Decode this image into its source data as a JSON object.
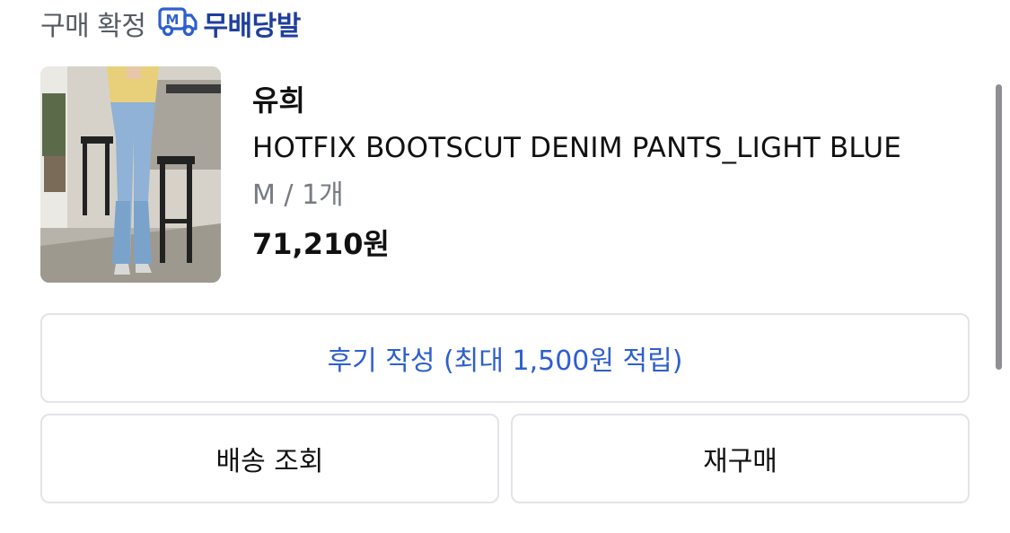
{
  "header": {
    "status": "구매 확정",
    "delivery_label": "무배당발",
    "delivery_icon": "delivery-truck-icon",
    "delivery_color": "#1f3f9d"
  },
  "product": {
    "brand": "유희",
    "name": "HOTFIX BOOTSCUT DENIM PANTS_LIGHT BLUE",
    "option": "M / 1개",
    "price": "71,210원"
  },
  "actions": {
    "review_label": "후기 작성 (최대 1,500원 적립)",
    "track_label": "배송 조회",
    "rebuy_label": "재구매"
  },
  "colors": {
    "accent_blue": "#2e5fcf",
    "border": "#e2e4e8",
    "muted_text": "#777b82"
  }
}
